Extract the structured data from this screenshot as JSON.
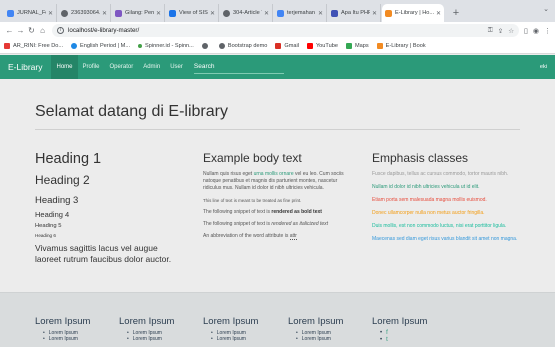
{
  "browser": {
    "tabs": [
      {
        "label": "JURNAL_Fo...",
        "color": "#4285f4"
      },
      {
        "label": "236393064...",
        "color": "#5f6368"
      },
      {
        "label": "Gilang: Peng...",
        "color": "#7e57c2"
      },
      {
        "label": "View of SISTE...",
        "color": "#1a73e8"
      },
      {
        "label": "304-Article Te...",
        "color": "#5f6368"
      },
      {
        "label": "terjemahan - ...",
        "color": "#4285f4"
      },
      {
        "label": "Apa Itu PHP? ...",
        "color": "#3f51b5"
      },
      {
        "label": "E-Library | Ho...",
        "color": "#f28b22"
      }
    ],
    "new_tab": "+",
    "url": "localhost/e-library-master/",
    "bookmarks": [
      {
        "label": "AR_RINI: Free Do...",
        "color": "#e53935"
      },
      {
        "label": "English Period | M...",
        "color": "#1e88e5"
      },
      {
        "label": "Spinner.id - Spinn...",
        "color": "#43a047"
      },
      {
        "label": "",
        "color": "#5f6368"
      },
      {
        "label": "Bootstrap demo",
        "color": "#5f6368"
      },
      {
        "label": "Gmail",
        "color": "#d93025"
      },
      {
        "label": "YouTube",
        "color": "#ff0000"
      },
      {
        "label": "Maps",
        "color": "#34a853"
      },
      {
        "label": "E-Library | Book",
        "color": "#f28b22"
      }
    ]
  },
  "navbar": {
    "brand": "E-Library",
    "links": [
      "Home",
      "Profile",
      "Operator",
      "Admin",
      "User"
    ],
    "search": "Search",
    "user": "eki"
  },
  "main": {
    "hero": "Selamat datang di E-library",
    "headings": {
      "h1": "Heading 1",
      "h2": "Heading 2",
      "h3": "Heading 3",
      "h4": "Heading 4",
      "h5": "Heading 5",
      "h6": "Heading 6",
      "lead": "Vivamus sagittis lacus vel augue laoreet rutrum faucibus dolor auctor."
    },
    "body": {
      "title": "Example body text",
      "p1_a": "Nullam quis risus eget ",
      "p1_link": "urna mollis ornare",
      "p1_b": " vel eu leo. Cum sociis natoque penatibus et magnis dis parturient montes, nascetur ridiculus mus. Nullam id dolor id nibh ultricies vehicula.",
      "fine": "This line of text is meant to be treated as fine print.",
      "bold_a": "The following snippet of text is ",
      "bold_b": "rendered as bold text",
      "italic_a": "The following snippet of text is ",
      "italic_b": "rendered as italicized text",
      "abbr_a": "An abbreviation of the word attribute is ",
      "abbr_b": "attr"
    },
    "emphasis": {
      "title": "Emphasis classes",
      "muted": "Fusce dapibus, tellus ac cursus commodo, tortor mauris nibh.",
      "primary": "Nullam id dolor id nibh ultricies vehicula ut id elit.",
      "danger": "Etiam porta sem malesuada magna mollis euismod.",
      "warning": "Donec ullamcorper nulla non metus auctor fringilla.",
      "success": "Duis mollis, est non commodo luctus, nisi erat porttitor ligula.",
      "info": "Maecenas sed diam eget risus varius blandit sit amet non magna."
    }
  },
  "footer": {
    "columns": [
      {
        "title": "Lorem Ipsum",
        "items": [
          "Lorem Ipsum",
          "Lorem Ipsum"
        ]
      },
      {
        "title": "Lorem Ipsum",
        "items": [
          "Lorem Ipsum",
          "Lorem Ipsum"
        ]
      },
      {
        "title": "Lorem Ipsum",
        "items": [
          "Lorem Ipsum",
          "Lorem Ipsum"
        ]
      },
      {
        "title": "Lorem Ipsum",
        "items": [
          "Lorem Ipsum",
          "Lorem Ipsum"
        ]
      },
      {
        "title": "Lorem Ipsum",
        "social": [
          "f",
          "t"
        ]
      }
    ]
  },
  "colors": {
    "navbar": "#2b9a79",
    "footer": "#d9dcdd"
  }
}
